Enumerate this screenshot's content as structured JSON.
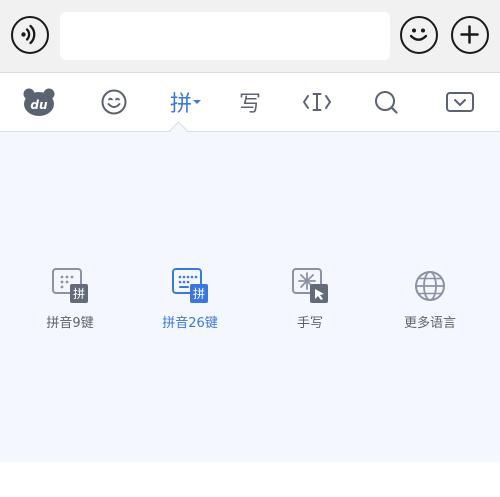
{
  "top_bar": {
    "input_value": "",
    "icons": [
      "voice-icon",
      "emoji-icon",
      "plus-icon"
    ]
  },
  "toolbar": {
    "pinyin_label": "拼",
    "handwrite_label": "写",
    "icons": [
      "du-bear-logo-icon",
      "smile-icon",
      "pinyin-icon",
      "handwrite-icon",
      "cursor-icon",
      "search-icon",
      "keyboard-collapse-icon"
    ],
    "active_color": "#3a79db",
    "icon_color": "#5b6373"
  },
  "layouts": [
    {
      "label": "拼音9键",
      "badge": "拼",
      "active": false
    },
    {
      "label": "拼音26键",
      "badge": "拼",
      "active": true
    },
    {
      "label": "手写",
      "active": false
    },
    {
      "label": "更多语言",
      "active": false
    }
  ]
}
